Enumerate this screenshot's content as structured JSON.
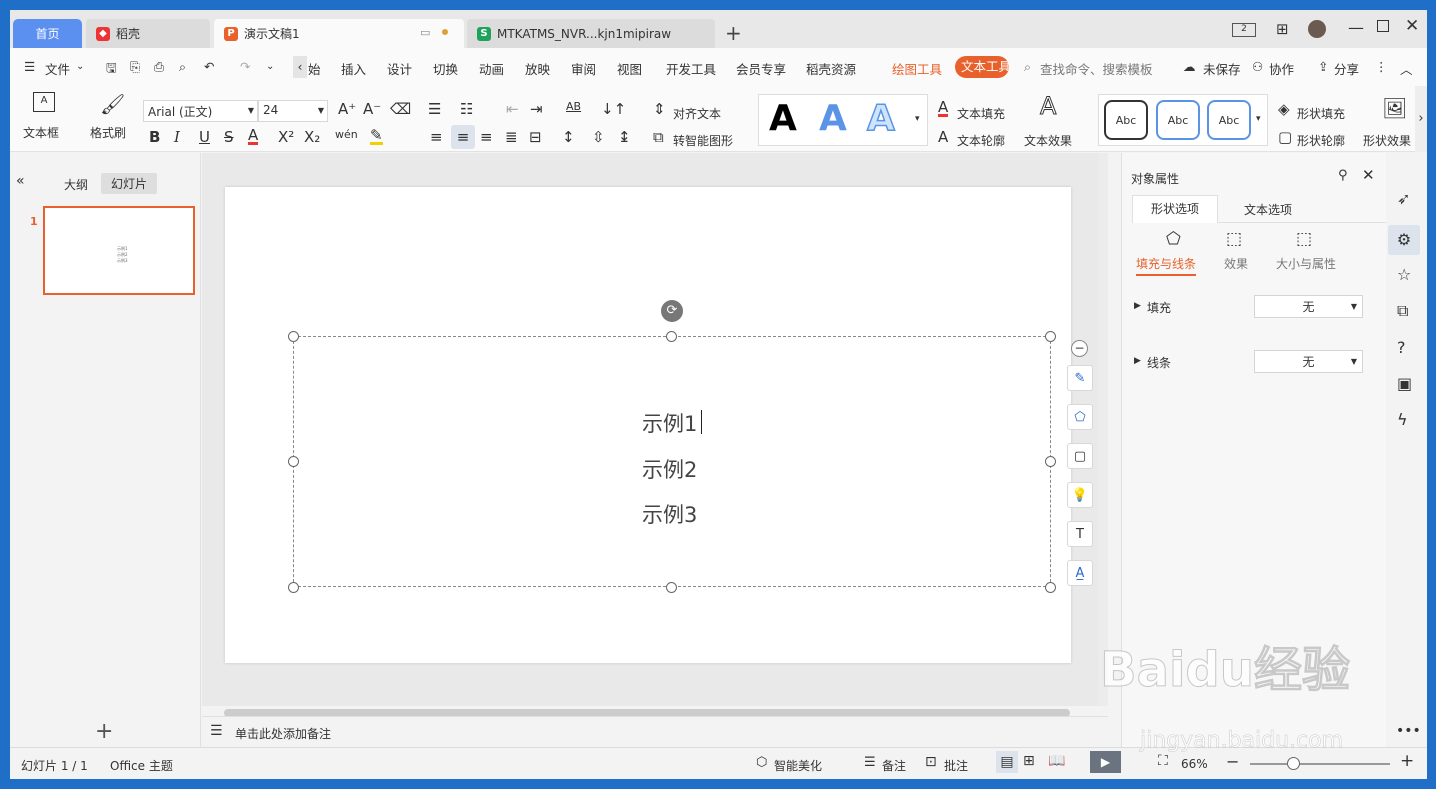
{
  "tabs": {
    "home": "首页",
    "daoke": "稻壳",
    "doc": "演示文稿1",
    "sheet": "MTKATMS_NVR...kjn1mipiraw",
    "new": "+"
  },
  "menu": {
    "file": "文件",
    "start": "始",
    "insert": "插入",
    "design": "设计",
    "transition": "切换",
    "animation": "动画",
    "play": "放映",
    "review": "审阅",
    "view": "视图",
    "devtools": "开发工具",
    "member": "会员专享",
    "resource": "稻壳资源",
    "drawing": "绘图工具",
    "texttool": "文本工具",
    "search": "查找命令、搜索模板",
    "unsaved": "未保存",
    "collab": "协作",
    "share": "分享"
  },
  "ribbon": {
    "textbox": "文本框",
    "format_painter": "格式刷",
    "font_name": "Arial (正文)",
    "font_size": "24",
    "align_text": "对齐文本",
    "smart_shape": "转智能图形",
    "text_fill": "文本填充",
    "text_outline": "文本轮廓",
    "text_effect": "文本效果",
    "shape_fill": "形状填充",
    "shape_outline": "形状轮廓",
    "shape_effect": "形状效果",
    "abc": "Abc",
    "style_letter": "A",
    "bold": "B",
    "italic": "I",
    "underline": "U",
    "strike": "S",
    "font_color": "A",
    "sup": "X²",
    "sub": "X₂",
    "pinyin": "wén"
  },
  "left": {
    "outline": "大纲",
    "slides": "幻灯片",
    "slide_num": "1",
    "add": "+"
  },
  "slide": {
    "lines": [
      "示例1",
      "示例2",
      "示例3"
    ],
    "thumb_lines": [
      "示例1",
      "示例2",
      "示例3"
    ]
  },
  "right": {
    "title": "对象属性",
    "tab_shape": "形状选项",
    "tab_text": "文本选项",
    "sub_fill": "填充与线条",
    "sub_effect": "效果",
    "sub_size": "大小与属性",
    "fill_label": "填充",
    "fill_value": "无",
    "line_label": "线条",
    "line_value": "无"
  },
  "notes": {
    "placeholder": "单击此处添加备注"
  },
  "status": {
    "slide": "幻灯片 1 / 1",
    "theme": "Office 主题",
    "beautify": "智能美化",
    "notes": "备注",
    "comment": "批注",
    "zoom": "66%"
  },
  "watermark": {
    "url": "jingyan.baidu.com",
    "brand": "Baidu经验"
  },
  "colors": {
    "accent": "#e8612c",
    "tab_home": "#5b8ff0",
    "frame": "#1f6fc8"
  }
}
